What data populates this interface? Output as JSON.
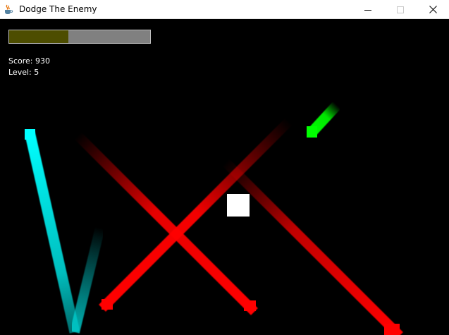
{
  "window": {
    "title": "Dodge The Enemy",
    "app_icon": "java-coffee-cup-icon",
    "controls": [
      "minimize-icon",
      "maximize-icon",
      "close-icon"
    ]
  },
  "hud": {
    "health_fraction": 0.42,
    "health_fill_color": "#4d4d00",
    "health_track_color": "#808080",
    "score_text": "Score: 930",
    "level_text": "Level: 5"
  },
  "colors": {
    "background": "#000000",
    "player": "#ffffff",
    "enemy_red": "#ff0000",
    "enemy_cyan": "#00ffff",
    "enemy_green": "#00ff00"
  }
}
